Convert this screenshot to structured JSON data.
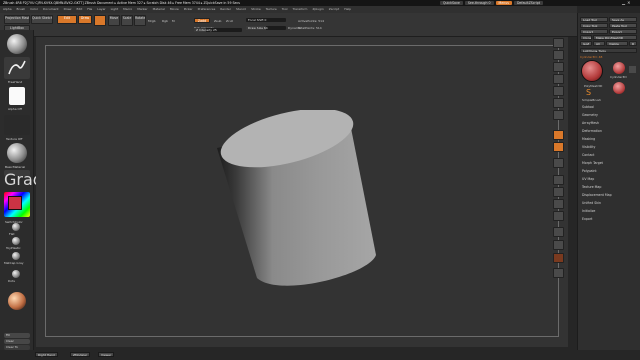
{
  "titlebar": {
    "text": "ZBrush 4R8 P2[7VU CJFN-KV9X-QBMN-BVX2-GKTT]  ZBrush Document   ▸ Active Mem 327 ▸ Scratch Disk 46 ▸ Free Mem 3744 ▸ ZQuickSave in 59 Secs",
    "quicksave": "QuickSave",
    "seethrough": "See-through 0",
    "menus": "Menus",
    "default_script": "DefaultZScript"
  },
  "menubar": [
    "Alpha",
    "Brush",
    "Color",
    "Document",
    "Draw",
    "Edit",
    "File",
    "Layer",
    "Light",
    "Macro",
    "Marker",
    "Material",
    "Movie",
    "Picker",
    "Preferences",
    "Render",
    "Stencil",
    "Stroke",
    "Texture",
    "Tool",
    "Transform",
    "Zplugin",
    "Zscript",
    "Help"
  ],
  "shelf": {
    "projection_master": "Projection\nMaster",
    "lightbox": "LightBox",
    "quick_sketch": "Quick\nSketch",
    "edit": "Edit",
    "draw": "Draw",
    "move": "Move",
    "scale": "Scale",
    "rotate": "Rotate",
    "mrgb": "Mrgb",
    "rgb": "Rgb",
    "m": "M",
    "zadd": "Zadd",
    "zsub": "Zsub",
    "zcut": "Zcut",
    "rgb_intensity": "Rgb Intensity",
    "z_intensity": "Z Intensity 25",
    "focal_shift": "Focal Shift 0",
    "draw_size": "Draw Size 64",
    "dynamic": "Dynamic",
    "active_points": "ActivePoints: 514",
    "total_points": "TotalPoints: 514"
  },
  "lefttray": {
    "standard": "Standard",
    "freehand": "FreeHand",
    "alpha_off": "Alpha Off",
    "texture_off": "Texture Off",
    "material": "BasicMaterial",
    "gradient": "Gradient",
    "switch_color": "SwitchColor",
    "alternate": "Alternate",
    "flat": "Flat",
    "toyplastic": "ToyPlastic",
    "skinshade": "SkinShade4",
    "mattcap": "MatCap Gray",
    "dots": "Dots",
    "claytubes": "ClayTubes",
    "fill": "Fill",
    "clear": "Clear",
    "clear_to": "Clear To"
  },
  "rightpanel": {
    "load_tool": "Load Tool",
    "save_as": "Save As",
    "copy_tool": "Copy Tool",
    "paste_tool": "Paste Tool",
    "import": "Import",
    "export": "Export",
    "clone": "Clone",
    "make_polymesh": "Make PolyMesh3D",
    "goz": "GoZ",
    "all": "All",
    "visible": "Visible",
    "r": "R",
    "lightbox_tools": "Lightbox▸ Tools",
    "cylinder_label": "Cylinder3D: 48",
    "cylinder3d": "Cylinder3D",
    "polymesh3d": "PolyMesh3D",
    "simple_brush": "SimpleBrush",
    "sections": [
      "Subtool",
      "Geometry",
      "ArrayMesh",
      "Deformation",
      "Masking",
      "Visibility",
      "Contact",
      "Morph Target",
      "Polypaint",
      "UV Map",
      "Texture Map",
      "Displacement Map",
      "Unified Skin",
      "Initialize",
      "Export"
    ]
  },
  "bottombar": {
    "right_hand": "Right Hand",
    "zmodeler": "ZModeler",
    "viewer": "Viewer"
  },
  "colors": {
    "accent": "#d9782a",
    "canvas": "#333333",
    "panel": "#2f2f2f"
  }
}
